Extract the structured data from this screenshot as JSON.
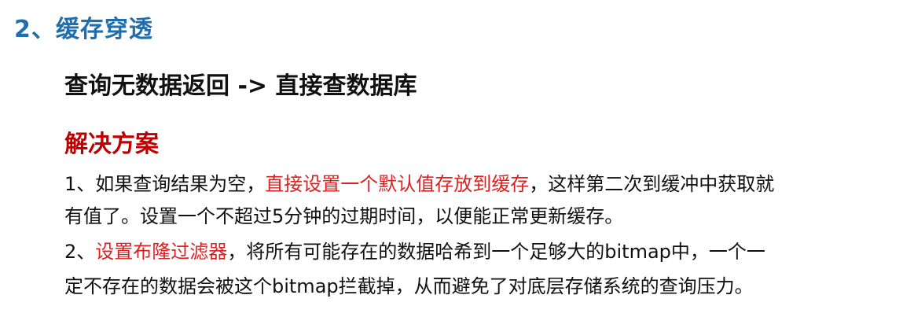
{
  "section": {
    "heading": "2、缓存穿透",
    "problem": "查询无数据返回 -> 直接查数据库",
    "solution_title": "解决方案"
  },
  "solutions": {
    "item1": {
      "prefix": "1、如果查询结果为空，",
      "highlight": "直接设置一个默认值存放到缓存",
      "suffix": "，这样第二次到缓冲中获取就",
      "continuation": "有值了。设置一个不超过5分钟的过期时间，以便能正常更新缓存。"
    },
    "item2": {
      "prefix": "2、",
      "highlight": "设置布隆过滤器",
      "suffix": "，将所有可能存在的数据哈希到一个足够大的bitmap中，一个一",
      "continuation": "定不存在的数据会被这个bitmap拦截掉，从而避免了对底层存储系统的查询压力。"
    }
  },
  "colors": {
    "heading": "#1f6fae",
    "solution_title": "#c00000",
    "highlight": "#e02020",
    "text": "#111111"
  }
}
